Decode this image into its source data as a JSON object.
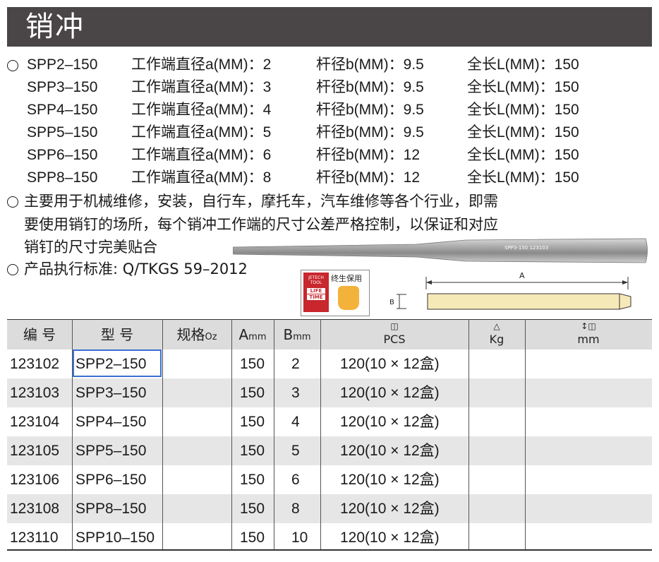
{
  "title": "销冲",
  "specs": [
    {
      "model": "SPP2–150",
      "tip_label": "工作端直径a(MM)：2",
      "shank_label": "杆径b(MM)：9.5",
      "length_label": "全长L(MM)：150"
    },
    {
      "model": "SPP3–150",
      "tip_label": "工作端直径a(MM)：3",
      "shank_label": "杆径b(MM)：9.5",
      "length_label": "全长L(MM)：150"
    },
    {
      "model": "SPP4–150",
      "tip_label": "工作端直径a(MM)：4",
      "shank_label": "杆径b(MM)：9.5",
      "length_label": "全长L(MM)：150"
    },
    {
      "model": "SPP5–150",
      "tip_label": "工作端直径a(MM)：5",
      "shank_label": "杆径b(MM)：9.5",
      "length_label": "全长L(MM)：150"
    },
    {
      "model": "SPP6–150",
      "tip_label": "工作端直径a(MM)：6",
      "shank_label": "杆径b(MM)：12",
      "length_label": "全长L(MM)：150"
    },
    {
      "model": "SPP8–150",
      "tip_label": "工作端直径a(MM)：8",
      "shank_label": "杆径b(MM)：12",
      "length_label": "全长L(MM)：150"
    }
  ],
  "description": {
    "line1": "主要用于机械维修，安装，自行车，摩托车，汽车维修等各个行业，即需",
    "line2": "要使用销钉的场所，每个销冲工作端的尺寸公差严格控制，以保证和对应",
    "line3": "销钉的尺寸完美贴合"
  },
  "standard": "产品执行标准: Q/TKGS 59–2012",
  "product_engraving": "SPP3-150  123103",
  "badge": {
    "label": "终生保用",
    "brand_top": "JETECH",
    "brand_sub": "TOOL",
    "life": "LIFE",
    "time": "TIME"
  },
  "diagram": {
    "label_a": "A",
    "label_b": "B"
  },
  "table": {
    "headers": {
      "code": "编  号",
      "model": "型  号",
      "spec_main": "规格",
      "spec_unit": "Oz",
      "a_main": "A",
      "a_unit": "mm",
      "b_main": "B",
      "b_unit": "mm",
      "pcs": "PCS",
      "kg": "Kg",
      "mm": "mm"
    },
    "header_icons": {
      "pcs": "box-icon",
      "kg": "weight-icon",
      "mm": "dimension-icon"
    },
    "rows": [
      {
        "code": "123102",
        "model": "SPP2–150",
        "spec": "",
        "a": "150",
        "b": "2",
        "pcs": "120(10 × 12盒)"
      },
      {
        "code": "123103",
        "model": "SPP3–150",
        "spec": "",
        "a": "150",
        "b": "3",
        "pcs": "120(10 × 12盒)"
      },
      {
        "code": "123104",
        "model": "SPP4–150",
        "spec": "",
        "a": "150",
        "b": "4",
        "pcs": "120(10 × 12盒)"
      },
      {
        "code": "123105",
        "model": "SPP5–150",
        "spec": "",
        "a": "150",
        "b": "5",
        "pcs": "120(10 × 12盒)"
      },
      {
        "code": "123106",
        "model": "SPP6–150",
        "spec": "",
        "a": "150",
        "b": "6",
        "pcs": "120(10 × 12盒)"
      },
      {
        "code": "123108",
        "model": "SPP8–150",
        "spec": "",
        "a": "150",
        "b": "8",
        "pcs": "120(10 × 12盒)"
      },
      {
        "code": "123110",
        "model": "SPP10–150",
        "spec": "",
        "a": "150",
        "b": "10",
        "pcs": "120(10 × 12盒)"
      }
    ]
  },
  "colors": {
    "title_bar": "#4a4546",
    "table_header": "#dcdcdc",
    "row_alt": "#e6e6e6",
    "selection": "#3b6fd1",
    "pin_body": "#f6e9b8",
    "badge_red": "#c8272d"
  }
}
